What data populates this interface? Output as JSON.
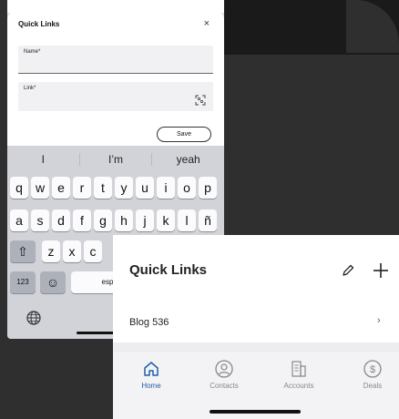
{
  "modal": {
    "title": "Quick Links",
    "close_glyph": "×",
    "name_label": "Name*",
    "link_label": "Link*",
    "save_label": "Save",
    "scan_icon": "qr-scan-icon"
  },
  "keyboard": {
    "suggestions": [
      "I",
      "I’m",
      "yeah"
    ],
    "row1": [
      "q",
      "w",
      "e",
      "r",
      "t",
      "y",
      "u",
      "i",
      "o",
      "p"
    ],
    "row2": [
      "a",
      "s",
      "d",
      "f",
      "g",
      "h",
      "j",
      "k",
      "l",
      "ñ"
    ],
    "row3": [
      "z",
      "x",
      "c"
    ],
    "shift_glyph": "⇧",
    "numbers_label": "123",
    "emoji_glyph": "☺",
    "space_label": "esp",
    "globe_icon": "globe-icon"
  },
  "quick_links": {
    "title": "Quick Links",
    "edit_icon": "pencil-icon",
    "add_icon": "plus-icon",
    "items": [
      {
        "label": "Blog 536",
        "chevron": "›"
      }
    ]
  },
  "tabbar": {
    "tabs": [
      {
        "label": "Home",
        "icon": "home-icon",
        "active": true
      },
      {
        "label": "Contacts",
        "icon": "contacts-icon",
        "active": false
      },
      {
        "label": "Accounts",
        "icon": "accounts-icon",
        "active": false
      },
      {
        "label": "Deals",
        "icon": "dollar-icon",
        "active": false
      }
    ]
  },
  "colors": {
    "accent": "#1f5fa8",
    "keyboard_bg": "#d2d3d8",
    "dark_bg": "#2f2f2f"
  }
}
